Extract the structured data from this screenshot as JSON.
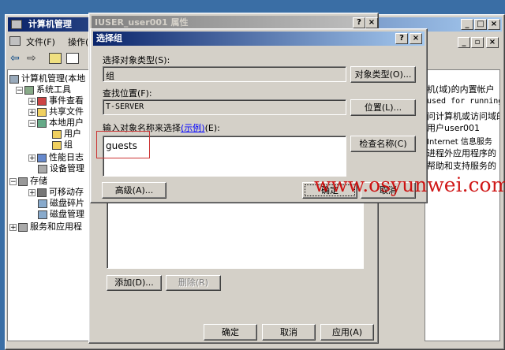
{
  "mmc": {
    "title": "计算机管理",
    "menu": [
      "文件(F)",
      "操作("
    ],
    "tree": [
      {
        "expander": "−",
        "label": "计算机管理(本地"
      },
      {
        "expander": "−",
        "label": "系统工具"
      },
      {
        "expander": "+",
        "label": "事件查看"
      },
      {
        "expander": "+",
        "label": "共享文件"
      },
      {
        "expander": "−",
        "label": "本地用户"
      },
      {
        "expander": "",
        "label": "用户"
      },
      {
        "expander": "",
        "label": "组"
      },
      {
        "expander": "+",
        "label": "性能日志"
      },
      {
        "expander": "",
        "label": "设备管理"
      },
      {
        "expander": "−",
        "label": "存储"
      },
      {
        "expander": "+",
        "label": "可移动存"
      },
      {
        "expander": "",
        "label": "磁盘碎片"
      },
      {
        "expander": "",
        "label": "磁盘管理"
      },
      {
        "expander": "+",
        "label": "服务和应用程"
      }
    ],
    "description_lines": [
      "机(域)的内置帐户",
      "used for running",
      "问计算机或访问域的",
      "用户user001",
      " Internet 信息服务",
      "进程外应用程序的",
      "帮助和支持服务的"
    ]
  },
  "props": {
    "title": "IUSER_user001 属性",
    "add_label": "添加(D)...",
    "remove_label": "删除(R)",
    "ok_label": "确定",
    "cancel_label": "取消",
    "apply_label": "应用(A)"
  },
  "select": {
    "title": "选择组",
    "object_type_label": "选择对象类型(S):",
    "object_type_value": "组",
    "object_type_button": "对象类型(O)...",
    "location_label": "查找位置(F):",
    "location_value": "T-SERVER",
    "location_button": "位置(L)...",
    "enter_names_label": "输入对象名称来选择",
    "examples_link": "(示例)",
    "enter_names_suffix": "(E):",
    "names_value": "guests",
    "check_names_button": "检查名称(C)",
    "advanced_button": "高级(A)...",
    "ok_button": "确定",
    "cancel_button": "取消"
  },
  "watermark": "www.osyunwei.com",
  "colors": {
    "desktop": "#3a6ea5",
    "title_active": "#0a246a",
    "highlight_box": "#cc3333",
    "watermark": "#cc0000"
  }
}
